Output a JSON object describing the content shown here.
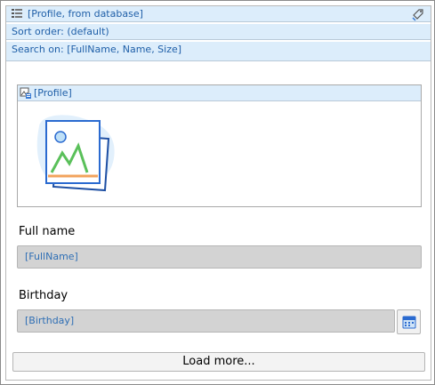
{
  "header": {
    "datasource": "[Profile, from database]",
    "sort_order": "Sort order: (default)",
    "search_on": "Search on: [FullName, Name, Size]"
  },
  "profile": {
    "title": "[Profile]"
  },
  "fields": {
    "fullname_label": "Full name",
    "fullname_value": "[FullName]",
    "birthday_label": "Birthday",
    "birthday_value": "[Birthday]"
  },
  "footer": {
    "load_more": "Load more..."
  },
  "icons": {
    "datasource": "list-datasource-icon",
    "header_right": "tag-icon",
    "profile": "image-edit-icon",
    "placeholder": "image-placeholder-icon",
    "calendar": "calendar-icon"
  },
  "colors": {
    "header_bg": "#dcedfb",
    "link_text": "#1f5fa8",
    "field_bg": "#d3d3d3"
  }
}
